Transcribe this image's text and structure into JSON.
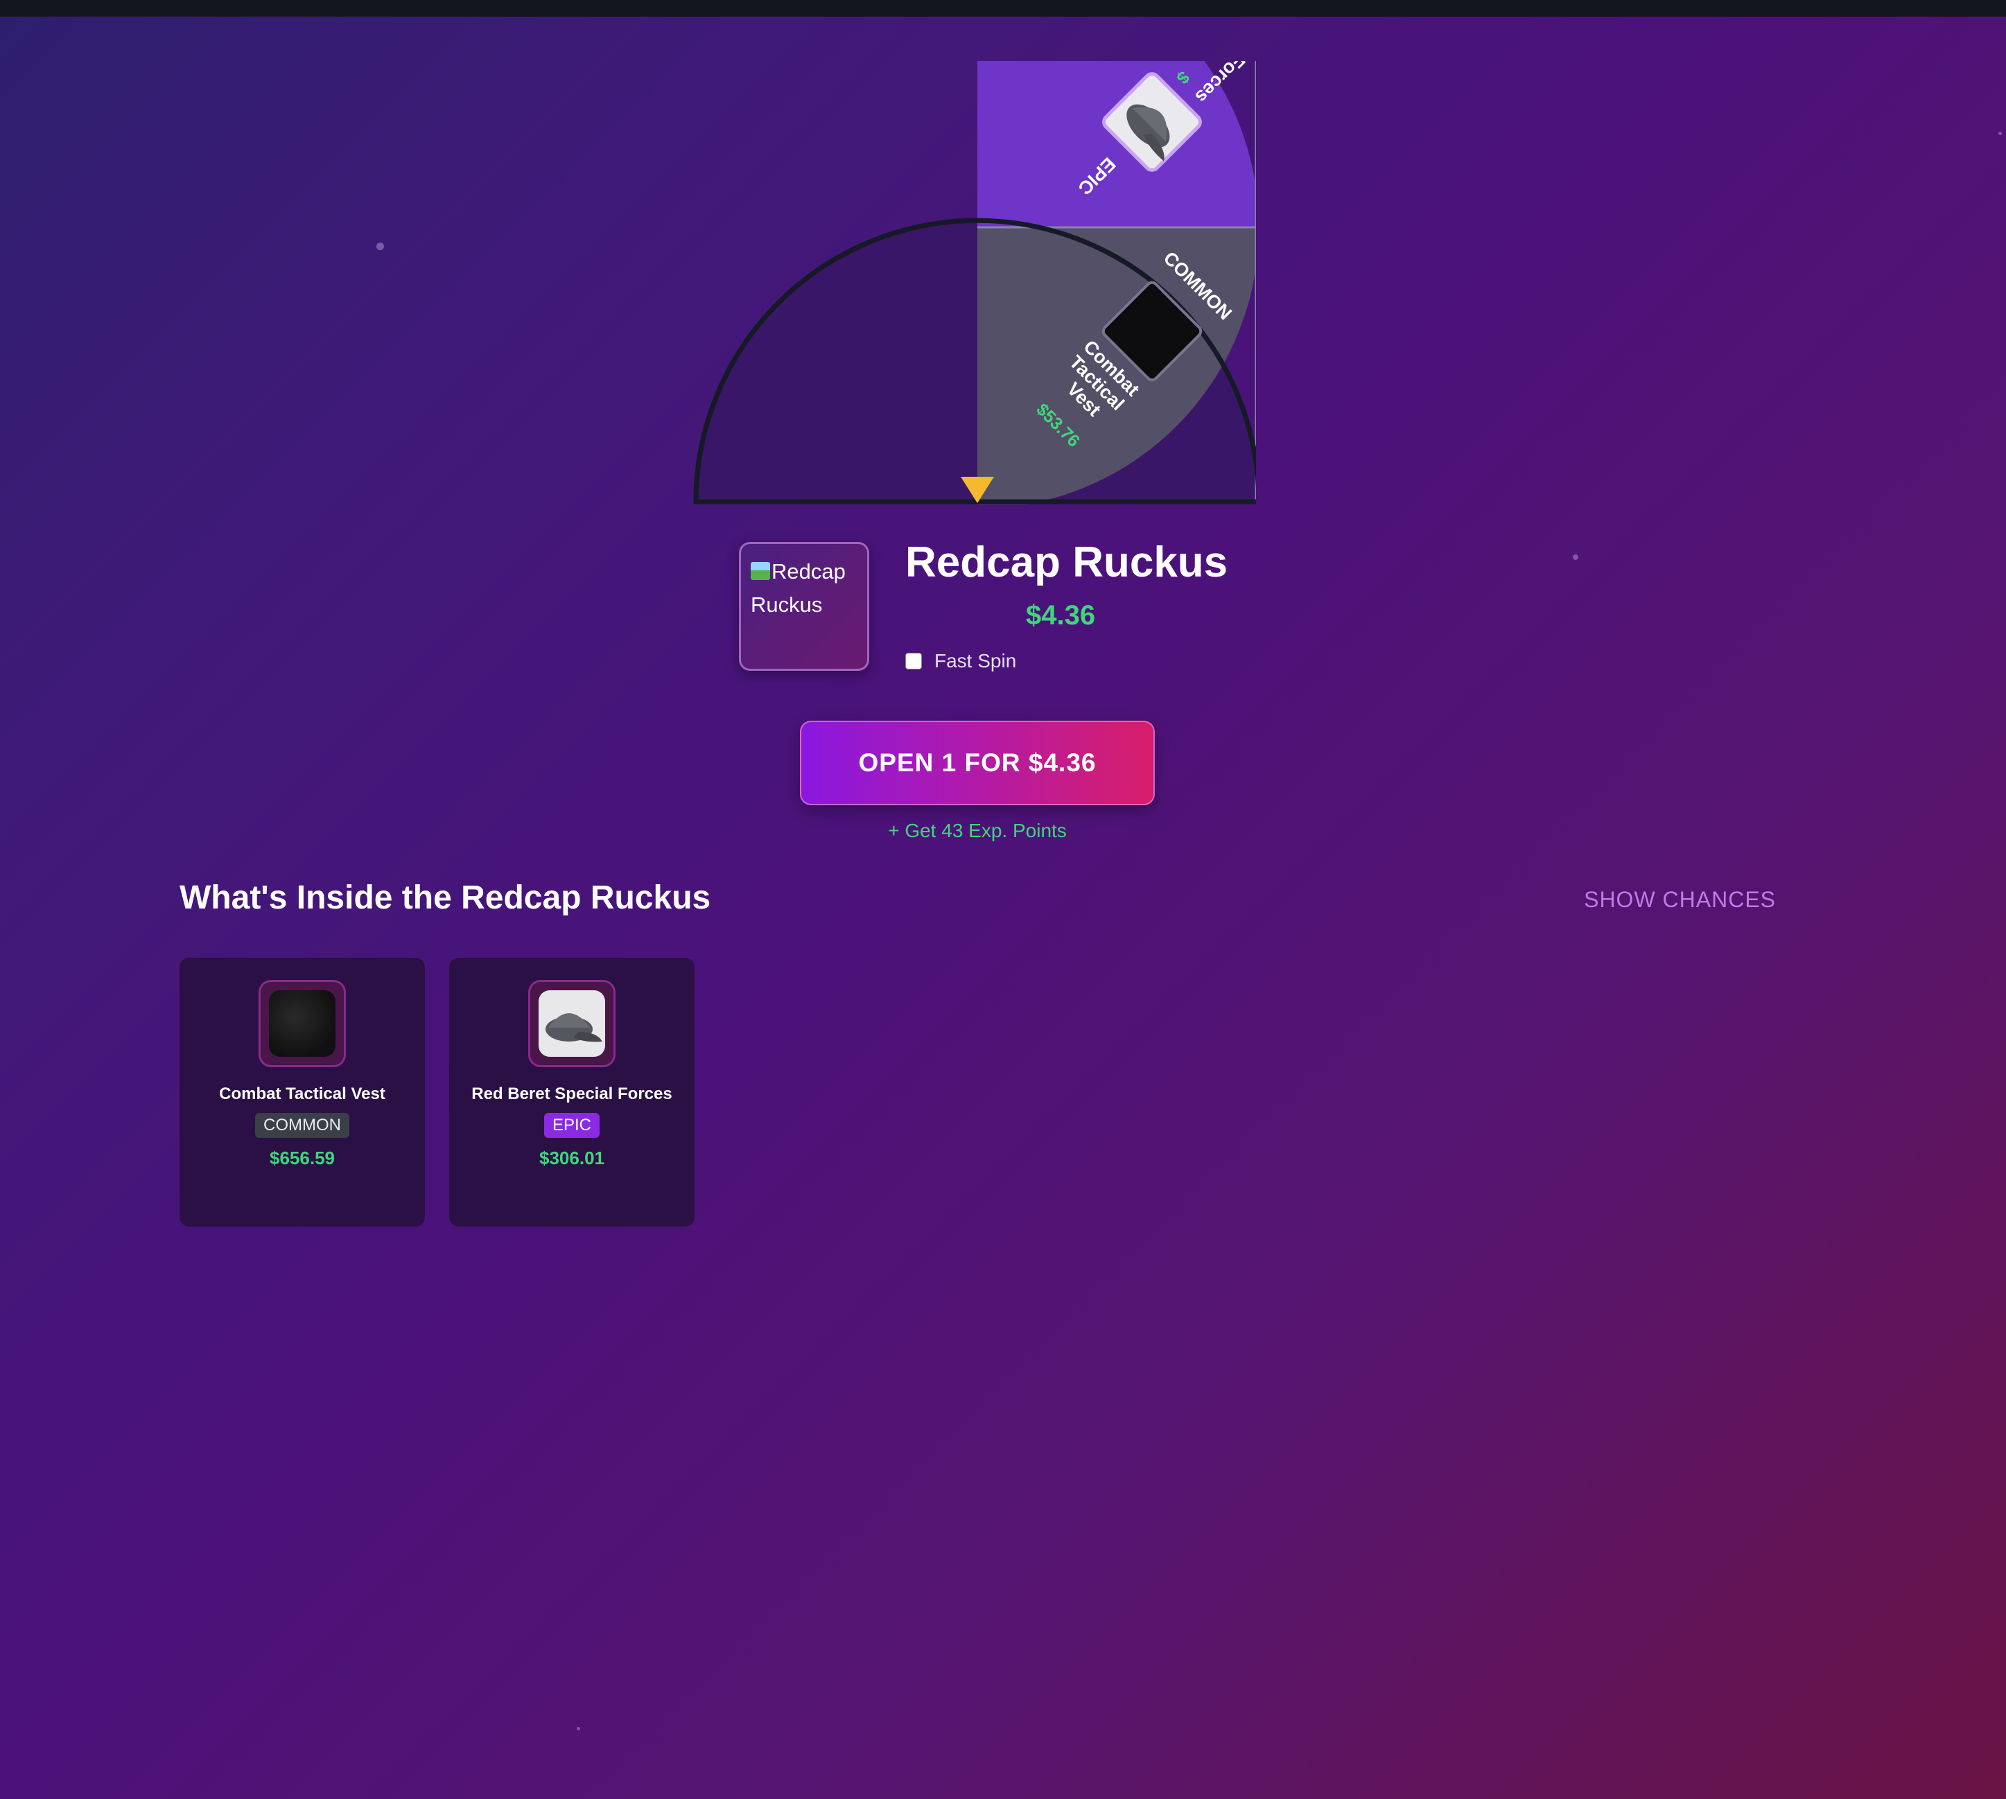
{
  "wheel": {
    "segments": [
      {
        "rarity": "EPIC",
        "name": "Red Beret Special Forces",
        "price": "$",
        "color": "#6e35c8"
      },
      {
        "rarity": "COMMON",
        "name": "Combat Tactical Vest",
        "price": "$53.76",
        "color": "#545068"
      }
    ],
    "pointer_color": "#f5b82e"
  },
  "case": {
    "image_alt": "Redcap Ruckus",
    "title": "Redcap Ruckus",
    "price": "$4.36",
    "fast_spin_label": "Fast Spin",
    "fast_spin_checked": false
  },
  "actions": {
    "open_label": "OPEN 1 FOR $4.36",
    "exp_text": "+ Get 43 Exp. Points"
  },
  "contents": {
    "title": "What's Inside the Redcap Ruckus",
    "show_chances_label": "SHOW CHANCES",
    "items": [
      {
        "name": "Combat Tactical Vest",
        "rarity": "COMMON",
        "price": "$656.59",
        "icon": "vest-icon"
      },
      {
        "name": "Red Beret Special Forces",
        "rarity": "EPIC",
        "price": "$306.01",
        "icon": "cap-icon"
      }
    ]
  },
  "colors": {
    "accent_green": "#3fd77a",
    "accent_purple": "#c07ae8",
    "epic": "#8a2be2",
    "common": "#3b3f48"
  }
}
